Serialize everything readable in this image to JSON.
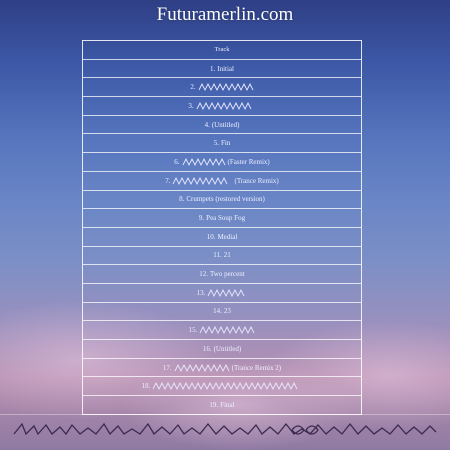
{
  "site": {
    "title": "Futuramerlin.com"
  },
  "table": {
    "header": "Track",
    "rows": [
      {
        "num": "1.",
        "title": "Initial",
        "glyph": false,
        "suffix": ""
      },
      {
        "num": "2.",
        "title": "",
        "glyph": true,
        "suffix": ""
      },
      {
        "num": "3.",
        "title": "",
        "glyph": true,
        "suffix": ""
      },
      {
        "num": "4.",
        "title": "(Untitled)",
        "glyph": false,
        "suffix": ""
      },
      {
        "num": "5.",
        "title": "Fin",
        "glyph": false,
        "suffix": ""
      },
      {
        "num": "6.",
        "title": "",
        "glyph": true,
        "suffix": "(Faster Remix)"
      },
      {
        "num": "7.",
        "title": "",
        "glyph": true,
        "suffix": "(Trance Remix)"
      },
      {
        "num": "8.",
        "title": "Crumpets (restored version)",
        "glyph": false,
        "suffix": ""
      },
      {
        "num": "9.",
        "title": "Pea Soup Fog",
        "glyph": false,
        "suffix": ""
      },
      {
        "num": "10.",
        "title": "Medial",
        "glyph": false,
        "suffix": ""
      },
      {
        "num": "11.",
        "title": "21",
        "glyph": false,
        "suffix": ""
      },
      {
        "num": "12.",
        "title": "Two percent",
        "glyph": false,
        "suffix": ""
      },
      {
        "num": "13.",
        "title": "",
        "glyph": true,
        "suffix": ""
      },
      {
        "num": "14.",
        "title": "23",
        "glyph": false,
        "suffix": ""
      },
      {
        "num": "15.",
        "title": "",
        "glyph": true,
        "suffix": ""
      },
      {
        "num": "16.",
        "title": "(Untitled)",
        "glyph": false,
        "suffix": ""
      },
      {
        "num": "17.",
        "title": "",
        "glyph": true,
        "suffix": "(Trance Remix 2)"
      },
      {
        "num": "18.",
        "title": "",
        "glyph": true,
        "suffix": ""
      },
      {
        "num": "19.",
        "title": "Final",
        "glyph": false,
        "suffix": ""
      }
    ]
  }
}
